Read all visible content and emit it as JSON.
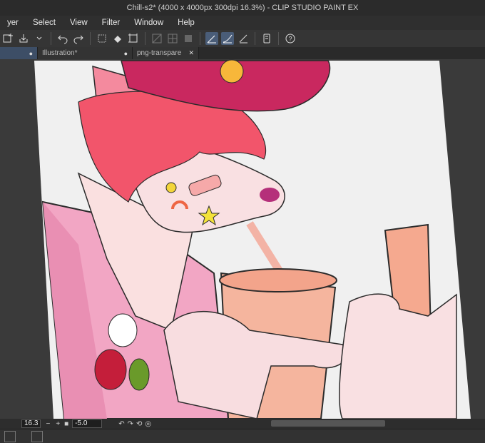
{
  "window": {
    "title": "Chill-s2* (4000 x 4000px 300dpi 16.3%)  - CLIP STUDIO PAINT EX"
  },
  "menu": [
    "yer",
    "Select",
    "View",
    "Filter",
    "Window",
    "Help"
  ],
  "tabs": [
    {
      "label": "",
      "close": "●"
    },
    {
      "label": "Illustration*",
      "close": "●"
    },
    {
      "label": "png-transparent",
      "close": "✕"
    }
  ],
  "status": {
    "zoom": "16.3",
    "angle": "-5.0"
  },
  "icons": [
    "new-layer-icon",
    "save-icon",
    "undo-icon",
    "redo-icon",
    "clear-icon",
    "fill-icon",
    "transform-icon",
    "snap-icon",
    "ruler-icon",
    "stroke-icon",
    "stabilize-icon",
    "pen-pressure-icon",
    "phone-icon",
    "help-icon"
  ],
  "colors": {
    "accent": "#4a5d78",
    "paper": "#f0f0f0"
  }
}
